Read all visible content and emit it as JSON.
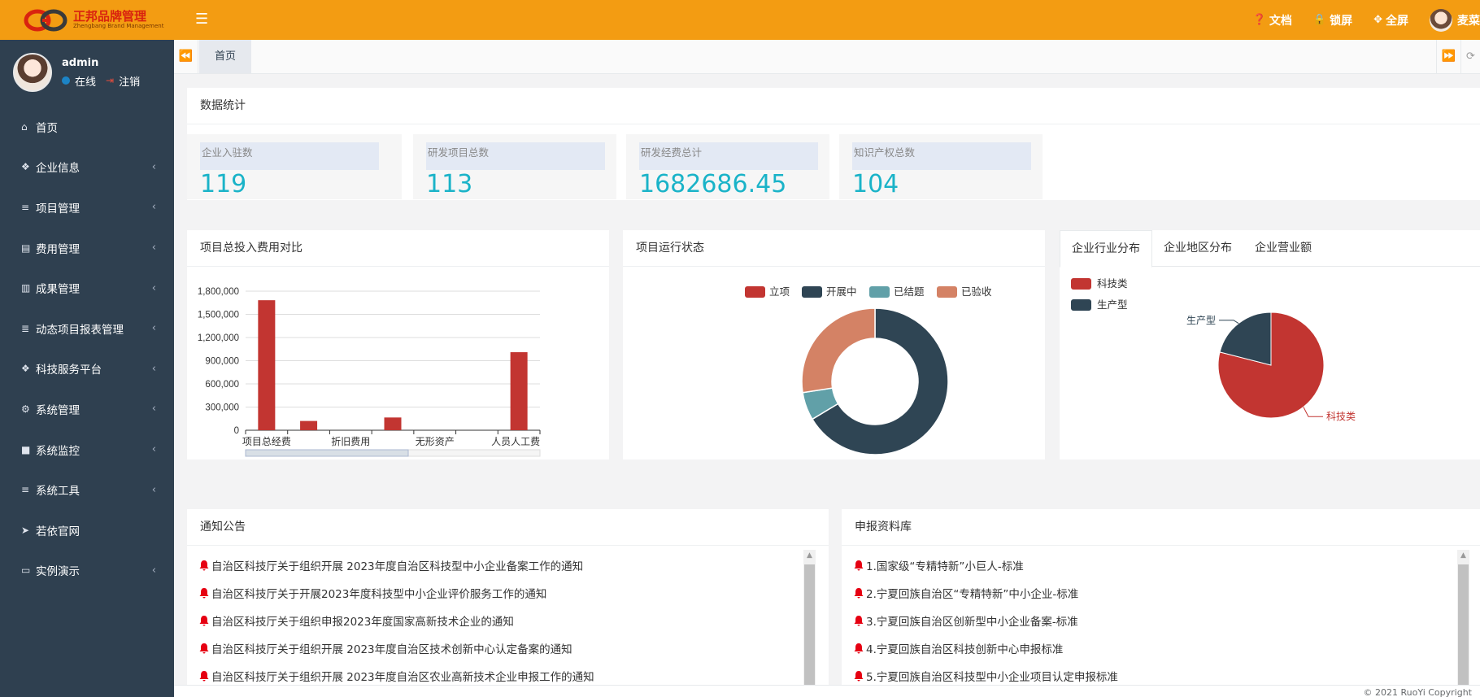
{
  "app": {
    "logo_title": "正邦品牌管理",
    "logo_subtitle": "Zhengbang Brand Management",
    "topbar": {
      "docs": "文档",
      "lock": "锁屏",
      "fullscreen": "全屏",
      "username": "麦菜"
    }
  },
  "user": {
    "name": "admin",
    "status": "在线",
    "logout": "注销"
  },
  "sidebar": {
    "items": [
      {
        "label": "首页",
        "icon": "home-icon",
        "has_arrow": false
      },
      {
        "label": "企业信息",
        "icon": "cubes-icon",
        "has_arrow": true
      },
      {
        "label": "项目管理",
        "icon": "list-icon",
        "has_arrow": true
      },
      {
        "label": "费用管理",
        "icon": "file-icon",
        "has_arrow": true
      },
      {
        "label": "成果管理",
        "icon": "bar-chart-icon",
        "has_arrow": true
      },
      {
        "label": "动态项目报表管理",
        "icon": "database-icon",
        "has_arrow": true
      },
      {
        "label": "科技服务平台",
        "icon": "cubes-icon",
        "has_arrow": true
      },
      {
        "label": "系统管理",
        "icon": "gear-icon",
        "has_arrow": true
      },
      {
        "label": "系统监控",
        "icon": "video-icon",
        "has_arrow": true
      },
      {
        "label": "系统工具",
        "icon": "list-icon",
        "has_arrow": true
      },
      {
        "label": "若依官网",
        "icon": "send-icon",
        "has_arrow": false
      },
      {
        "label": "实例演示",
        "icon": "desktop-icon",
        "has_arrow": true
      }
    ]
  },
  "tabs": {
    "home": "首页"
  },
  "stats": {
    "title": "数据统计",
    "cards": [
      {
        "label": "企业入驻数",
        "value": "119"
      },
      {
        "label": "研发项目总数",
        "value": "113"
      },
      {
        "label": "研发经费总计",
        "value": "1682686.45"
      },
      {
        "label": "知识产权总数",
        "value": "104"
      }
    ]
  },
  "panels": {
    "cost_title": "项目总投入费用对比",
    "status_title": "项目运行状态",
    "dist_tabs": [
      "企业行业分布",
      "企业地区分布",
      "企业营业额"
    ],
    "notice_title": "通知公告",
    "library_title": "申报资料库"
  },
  "chart_data": [
    {
      "type": "bar",
      "categories": [
        "项目总经费",
        "",
        "折旧费用",
        "",
        "无形资产",
        "",
        "人员人工费"
      ],
      "x_tick_labels": [
        "项目总经费",
        "折旧费用",
        "无形资产",
        "人员人工费"
      ],
      "values": [
        1682686,
        120000,
        0,
        165000,
        0,
        0,
        1010000
      ],
      "ylim": [
        0,
        1800000
      ],
      "y_ticks": [
        0,
        300000,
        600000,
        900000,
        1200000,
        1500000,
        1800000
      ],
      "y_tick_labels": [
        "0",
        "300,000",
        "600,000",
        "900,000",
        "1,200,000",
        "1,500,000",
        "1,800,000"
      ],
      "color": "#c23531",
      "grid": true
    },
    {
      "type": "pie",
      "donut": true,
      "legend_position": "top",
      "slices": [
        {
          "name": "立项",
          "value": 0,
          "color": "#c23531"
        },
        {
          "name": "开展中",
          "value": 75,
          "color": "#2f4554"
        },
        {
          "name": "已结题",
          "value": 7,
          "color": "#61a0a8"
        },
        {
          "name": "已验收",
          "value": 31,
          "color": "#d48265"
        }
      ]
    },
    {
      "type": "pie",
      "donut": false,
      "legend_position": "top-left",
      "slices": [
        {
          "name": "科技类",
          "value": 94,
          "color": "#c23531"
        },
        {
          "name": "生产型",
          "value": 25,
          "color": "#2f4554"
        }
      ]
    }
  ],
  "notices": [
    "自治区科技厅关于组织开展 2023年度自治区科技型中小企业备案工作的通知",
    "自治区科技厅关于开展2023年度科技型中小企业评价服务工作的通知",
    "自治区科技厅关于组织申报2023年度国家高新技术企业的通知",
    "自治区科技厅关于组织开展 2023年度自治区技术创新中心认定备案的通知",
    "自治区科技厅关于组织开展 2023年度自治区农业高新技术企业申报工作的通知"
  ],
  "library": [
    "1.国家级“专精特新”小巨人-标准",
    "2.宁夏回族自治区“专精特新”中小企业-标准",
    "3.宁夏回族自治区创新型中小企业备案-标准",
    "4.宁夏回族自治区科技创新中心申报标准",
    "5.宁夏回族自治区科技型中小企业项目认定申报标准"
  ],
  "footer": {
    "copyright": "© 2021 RuoYi Copyright"
  },
  "colors": {
    "topbar": "#f39c12",
    "sidebar": "#2f4050",
    "stat_value": "#1ab3c8",
    "bell": "#e60012"
  }
}
